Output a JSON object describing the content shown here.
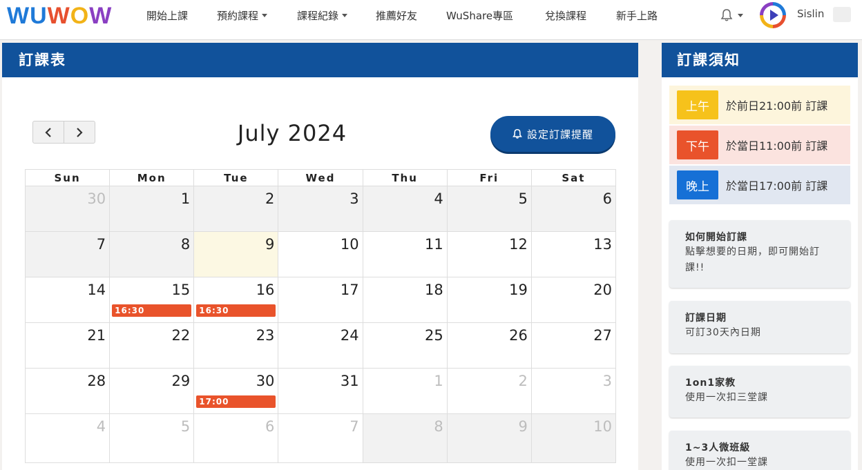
{
  "logo": {
    "chars": [
      "W",
      "U",
      "W",
      "O",
      "W"
    ]
  },
  "nav": {
    "items": [
      {
        "label": "開始上課",
        "dropdown": false
      },
      {
        "label": "預約課程",
        "dropdown": true
      },
      {
        "label": "課程紀錄",
        "dropdown": true
      },
      {
        "label": "推薦好友",
        "dropdown": false
      },
      {
        "label": "WuShare專區",
        "dropdown": false
      },
      {
        "label": "兌換課程",
        "dropdown": false
      },
      {
        "label": "新手上路",
        "dropdown": false
      }
    ],
    "username": "Sislin"
  },
  "main": {
    "header": "訂課表",
    "month_title": "July 2024",
    "remind_label": "設定訂課提醒",
    "weekdays": [
      "Sun",
      "Mon",
      "Tue",
      "Wed",
      "Thu",
      "Fri",
      "Sat"
    ],
    "days": [
      {
        "n": "30",
        "other": true,
        "off": true
      },
      {
        "n": "1",
        "off": true
      },
      {
        "n": "2",
        "off": true
      },
      {
        "n": "3",
        "off": true
      },
      {
        "n": "4",
        "off": true
      },
      {
        "n": "5",
        "off": true
      },
      {
        "n": "6",
        "off": true
      },
      {
        "n": "7",
        "off": true
      },
      {
        "n": "8",
        "off": true
      },
      {
        "n": "9",
        "today": true
      },
      {
        "n": "10"
      },
      {
        "n": "11"
      },
      {
        "n": "12"
      },
      {
        "n": "13"
      },
      {
        "n": "14"
      },
      {
        "n": "15",
        "event": "16:30"
      },
      {
        "n": "16",
        "event": "16:30"
      },
      {
        "n": "17"
      },
      {
        "n": "18"
      },
      {
        "n": "19"
      },
      {
        "n": "20"
      },
      {
        "n": "21"
      },
      {
        "n": "22"
      },
      {
        "n": "23"
      },
      {
        "n": "24"
      },
      {
        "n": "25"
      },
      {
        "n": "26"
      },
      {
        "n": "27"
      },
      {
        "n": "28"
      },
      {
        "n": "29"
      },
      {
        "n": "30",
        "event": "17:00"
      },
      {
        "n": "31"
      },
      {
        "n": "1",
        "other": true
      },
      {
        "n": "2",
        "other": true
      },
      {
        "n": "3",
        "other": true
      },
      {
        "n": "4",
        "other": true
      },
      {
        "n": "5",
        "other": true
      },
      {
        "n": "6",
        "other": true
      },
      {
        "n": "7",
        "other": true
      },
      {
        "n": "8",
        "other": true,
        "off": true
      },
      {
        "n": "9",
        "other": true,
        "off": true
      },
      {
        "n": "10",
        "other": true,
        "off": true
      }
    ]
  },
  "side": {
    "header": "訂課須知",
    "slots": [
      {
        "tag": "上午",
        "text": "於前日21:00前 訂課",
        "tag_color": "#f6c21b",
        "bg": "#fdf5dc"
      },
      {
        "tag": "下午",
        "text": "於當日11:00前 訂課",
        "tag_color": "#e9532b",
        "bg": "#fbe3df"
      },
      {
        "tag": "晚上",
        "text": "於當日17:00前 訂課",
        "tag_color": "#1670d6",
        "bg": "#e1e7f1"
      }
    ],
    "infos": [
      {
        "title": "如何開始訂課",
        "desc": "點擊想要的日期，即可開始訂課!!"
      },
      {
        "title": "訂課日期",
        "desc": "可訂30天內日期"
      },
      {
        "title": "1on1家教",
        "desc": "使用一次扣三堂課"
      },
      {
        "title": "1~3人微班級",
        "desc": "使用一次扣一堂課"
      }
    ]
  },
  "colors": {
    "primary": "#11529b",
    "event": "#e9532b"
  }
}
